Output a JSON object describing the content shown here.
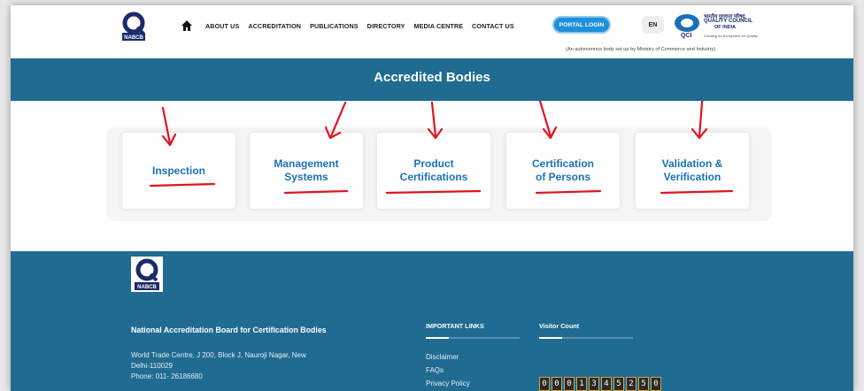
{
  "header": {
    "logo_text": "NABCB",
    "nav": [
      "ABOUT US",
      "ACCREDITATION",
      "PUBLICATIONS",
      "DIRECTORY",
      "MEDIA CENTRE",
      "CONTACT US"
    ],
    "portal_label": "PORTAL LOGIN",
    "lang": "EN",
    "qci_hindi": "भारतीय गुणवत्ता परिषद्",
    "qci_name": "QUALITY COUNCIL",
    "qci_india": "OF INDIA",
    "qci_abbr": "QCI",
    "qci_tagline": "Creating an Ecosystem for Quality",
    "autonomous_note": "(An autonomous body set up by Ministry of Commerce and Industry)"
  },
  "banner": {
    "title": "Accredited Bodies"
  },
  "cards": [
    {
      "line1": "Inspection",
      "line2": ""
    },
    {
      "line1": "Management",
      "line2": "Systems"
    },
    {
      "line1": "Product",
      "line2": "Certifications"
    },
    {
      "line1": "Certification",
      "line2": "of Persons"
    },
    {
      "line1": "Validation &",
      "line2": "Verification"
    }
  ],
  "footer": {
    "logo_text": "NABCB",
    "org_name": "National Accreditation Board for Certification Bodies",
    "address_line1": "World Trade Centre, J 200, Block J, Nauroji Nagar, New",
    "address_line2": "Delhi-110029",
    "phone": "Phone:  011- 26186680",
    "important_links_heading": "IMPORTANT LINKS",
    "links": [
      "Disclaimer",
      "FAQs",
      "Privacy Policy"
    ],
    "visitor_heading": "Visitor Count",
    "visitor_digits": [
      "0",
      "0",
      "0",
      "1",
      "3",
      "4",
      "5",
      "2",
      "5",
      "0"
    ]
  },
  "colors": {
    "brand_blue": "#1f6b91",
    "link_blue": "#1a72b8",
    "portal_blue": "#1e8fd8",
    "annotation_red": "#e0141e"
  }
}
